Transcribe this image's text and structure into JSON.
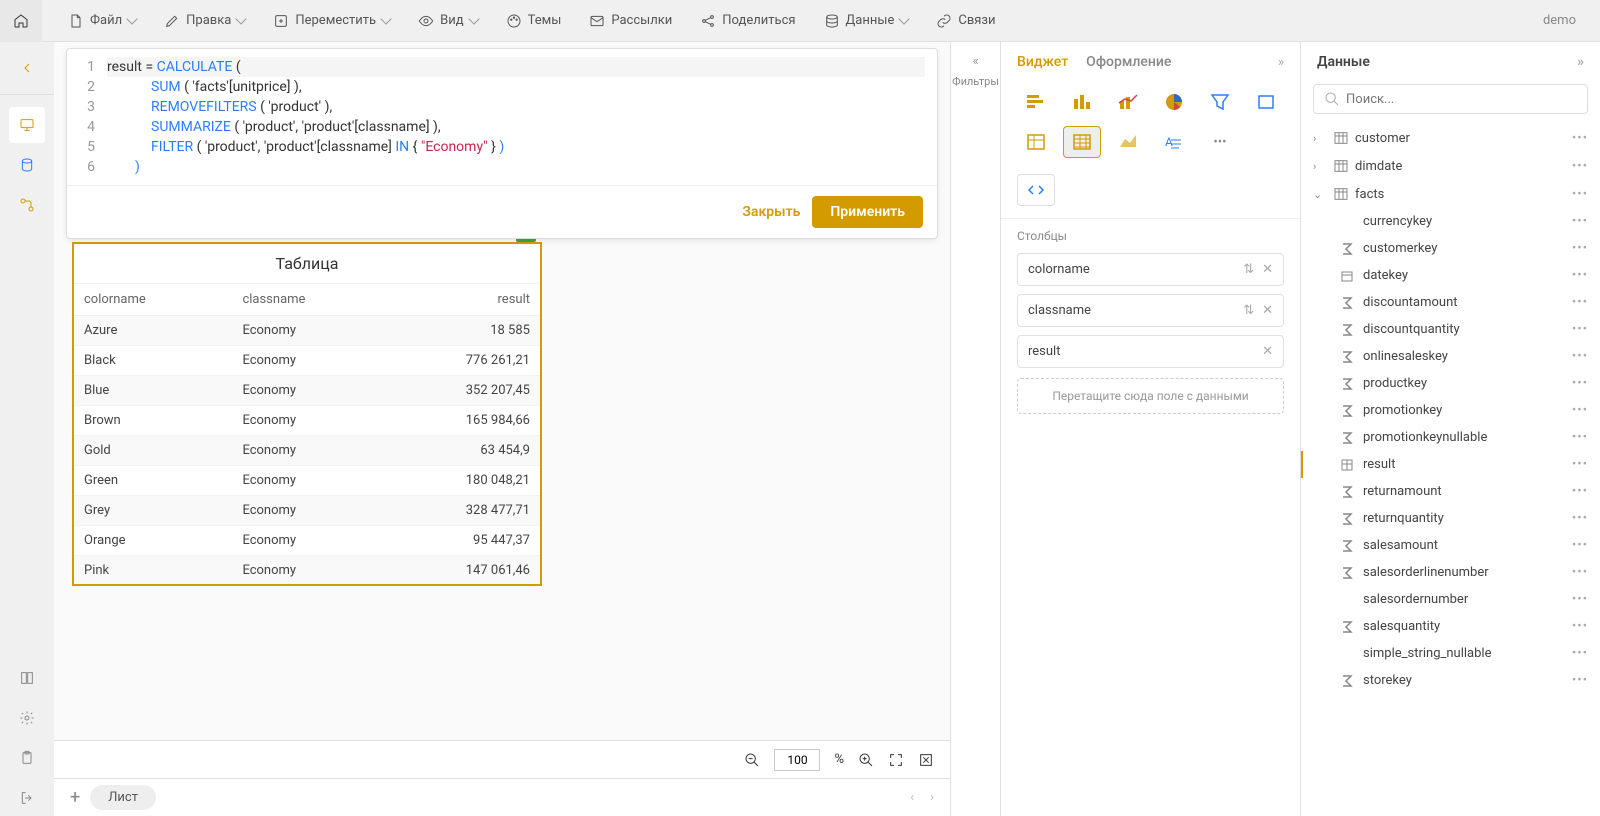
{
  "topbar": {
    "file": "Файл",
    "edit": "Правка",
    "move": "Переместить",
    "view": "Вид",
    "themes": "Темы",
    "mail": "Рассылки",
    "share": "Поделиться",
    "data": "Данные",
    "links": "Связи",
    "user": "demo"
  },
  "formula": {
    "lines": [
      "1",
      "2",
      "3",
      "4",
      "5",
      "6"
    ],
    "close": "Закрыть",
    "apply": "Применить",
    "tok": {
      "result": "result = ",
      "calculate": "CALCULATE",
      "open": " (",
      "sum": "SUM",
      "sum_arg": " ( 'facts'[unitprice] ),",
      "removefilters": "REMOVEFILTERS",
      "rf_arg": " ( 'product' ),",
      "summarize": "SUMMARIZE",
      "sm_arg": " ( 'product', 'product'[classname] ),",
      "filter": "FILTER",
      "fl_a": " ( 'product', 'product'[classname] ",
      "in": "IN",
      "cb": " { ",
      "econ": "\"Economy\"",
      "cb2": " } ",
      "close_p": ")"
    }
  },
  "table": {
    "title": "Таблица",
    "cols": [
      "colorname",
      "classname",
      "result"
    ],
    "rows": [
      [
        "Azure",
        "Economy",
        "18 585"
      ],
      [
        "Black",
        "Economy",
        "776 261,21"
      ],
      [
        "Blue",
        "Economy",
        "352 207,45"
      ],
      [
        "Brown",
        "Economy",
        "165 984,66"
      ],
      [
        "Gold",
        "Economy",
        "63 454,9"
      ],
      [
        "Green",
        "Economy",
        "180 048,21"
      ],
      [
        "Grey",
        "Economy",
        "328 477,71"
      ],
      [
        "Orange",
        "Economy",
        "95 447,37"
      ],
      [
        "Pink",
        "Economy",
        "147 061,46"
      ]
    ]
  },
  "zoom": {
    "value": "100",
    "pct": "%"
  },
  "sheet": {
    "tab": "Лист"
  },
  "filters": {
    "label": "Фильтры"
  },
  "widget": {
    "tab_widget": "Виджет",
    "tab_style": "Оформление",
    "section_cols": "Столбцы",
    "fields": [
      "colorname",
      "classname",
      "result"
    ],
    "drop": "Перетащите сюда поле с данными"
  },
  "data_panel": {
    "title": "Данные",
    "search_ph": "Поиск...",
    "tables": [
      {
        "name": "customer",
        "expanded": false
      },
      {
        "name": "dimdate",
        "expanded": false
      },
      {
        "name": "facts",
        "expanded": true,
        "fields": [
          {
            "name": "currencykey",
            "type": "text"
          },
          {
            "name": "customerkey",
            "type": "num"
          },
          {
            "name": "datekey",
            "type": "date"
          },
          {
            "name": "discountamount",
            "type": "num"
          },
          {
            "name": "discountquantity",
            "type": "num"
          },
          {
            "name": "onlinesaleskey",
            "type": "num"
          },
          {
            "name": "productkey",
            "type": "num"
          },
          {
            "name": "promotionkey",
            "type": "num"
          },
          {
            "name": "promotionkeynullable",
            "type": "num"
          },
          {
            "name": "result",
            "type": "calc",
            "selected": true
          },
          {
            "name": "returnamount",
            "type": "num"
          },
          {
            "name": "returnquantity",
            "type": "num"
          },
          {
            "name": "salesamount",
            "type": "num"
          },
          {
            "name": "salesorderlinenumber",
            "type": "num"
          },
          {
            "name": "salesordernumber",
            "type": "text"
          },
          {
            "name": "salesquantity",
            "type": "num"
          },
          {
            "name": "simple_string_nullable",
            "type": "text"
          },
          {
            "name": "storekey",
            "type": "num"
          }
        ]
      }
    ]
  }
}
